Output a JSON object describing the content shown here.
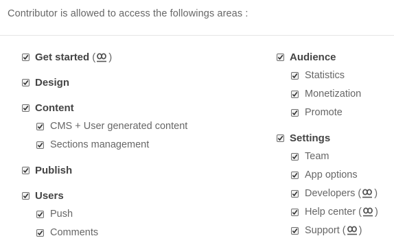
{
  "header": {
    "title": "Contributor is allowed to access the followings areas :"
  },
  "left": {
    "get_started": {
      "label": "Get started",
      "suffix_open": "(",
      "suffix_close": ")"
    },
    "design": {
      "label": "Design"
    },
    "content": {
      "label": "Content",
      "items": [
        {
          "label": "CMS + User generated content"
        },
        {
          "label": "Sections management"
        }
      ]
    },
    "publish": {
      "label": "Publish"
    },
    "users": {
      "label": "Users",
      "items": [
        {
          "label": "Push"
        },
        {
          "label": "Comments"
        }
      ]
    }
  },
  "right": {
    "audience": {
      "label": "Audience",
      "items": [
        {
          "label": "Statistics"
        },
        {
          "label": "Monetization"
        },
        {
          "label": "Promote"
        }
      ]
    },
    "settings": {
      "label": "Settings",
      "items": [
        {
          "label": "Team"
        },
        {
          "label": "App options"
        },
        {
          "label": "Developers",
          "suffix_open": "(",
          "suffix_close": ")"
        },
        {
          "label": "Help center",
          "suffix_open": "(",
          "suffix_close": ")"
        },
        {
          "label": "Support",
          "suffix_open": "(",
          "suffix_close": ")"
        }
      ]
    }
  },
  "icons": {
    "checkbox": "checkmark-icon",
    "glyph": "people-icon"
  }
}
